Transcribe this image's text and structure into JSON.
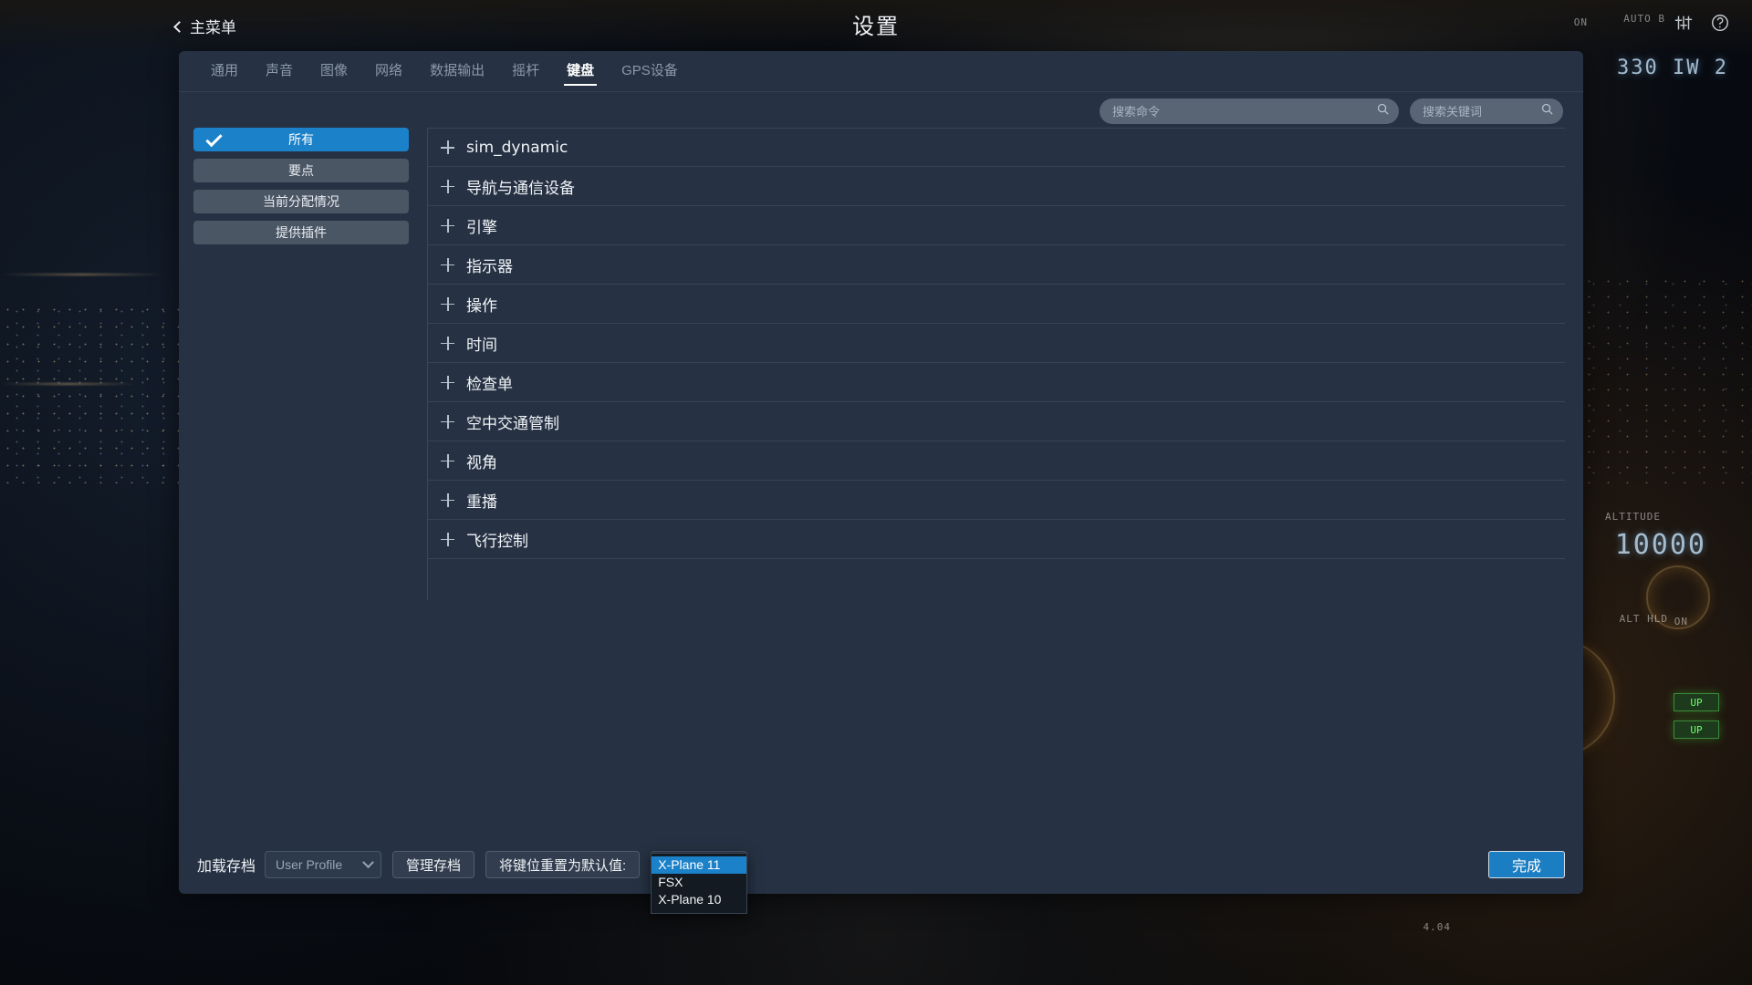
{
  "header": {
    "back_label": "主菜单",
    "title": "设置",
    "icons": [
      {
        "name": "sliders-icon",
        "glyph": "sliders"
      },
      {
        "name": "help-icon",
        "glyph": "question"
      }
    ]
  },
  "tabs": [
    {
      "label": "通用",
      "active": false
    },
    {
      "label": "声音",
      "active": false
    },
    {
      "label": "图像",
      "active": false
    },
    {
      "label": "网络",
      "active": false
    },
    {
      "label": "数据输出",
      "active": false
    },
    {
      "label": "摇杆",
      "active": false
    },
    {
      "label": "键盘",
      "active": true
    },
    {
      "label": "GPS设备",
      "active": false
    }
  ],
  "search": {
    "commands": {
      "value": "",
      "placeholder": "搜索命令",
      "icon": "search-icon"
    },
    "keywords": {
      "value": "",
      "placeholder": "搜索关键词",
      "icon": "search-icon"
    }
  },
  "sidebar": {
    "items": [
      {
        "label": "所有",
        "selected": true
      },
      {
        "label": "要点",
        "selected": false
      },
      {
        "label": "当前分配情况",
        "selected": false
      },
      {
        "label": "提供插件",
        "selected": false
      }
    ]
  },
  "categories": [
    {
      "label": "sim_dynamic",
      "expander": "plus-icon",
      "latin": true
    },
    {
      "label": "导航与通信设备",
      "expander": "plus-icon",
      "latin": false
    },
    {
      "label": "引擎",
      "expander": "plus-icon",
      "latin": false
    },
    {
      "label": "指示器",
      "expander": "plus-icon",
      "latin": false
    },
    {
      "label": "操作",
      "expander": "plus-icon",
      "latin": false
    },
    {
      "label": "时间",
      "expander": "plus-icon",
      "latin": false
    },
    {
      "label": "检查单",
      "expander": "plus-icon",
      "latin": false
    },
    {
      "label": "空中交通管制",
      "expander": "plus-icon",
      "latin": false
    },
    {
      "label": "视角",
      "expander": "plus-icon",
      "latin": false
    },
    {
      "label": "重播",
      "expander": "plus-icon",
      "latin": false
    },
    {
      "label": "飞行控制",
      "expander": "plus-icon",
      "latin": false
    }
  ],
  "bottom_bar": {
    "load_profile_label": "加载存档",
    "profile_select": {
      "value": "User Profile",
      "caret": "chevron-down-icon"
    },
    "manage_profiles_label": "管理存档",
    "reset_label": "将键位重置为默认值:",
    "reset_dropdown": {
      "value": "X-Plane 11",
      "open": true,
      "options": [
        {
          "label": "X-Plane 11",
          "selected": true
        },
        {
          "label": "FSX",
          "selected": false
        },
        {
          "label": "X-Plane 10",
          "selected": false
        }
      ]
    },
    "done_label": "完成"
  },
  "colors": {
    "accent": "#1b81c8",
    "panel": "#263243",
    "sidebar_button": "#4b5665",
    "text_primary": "#f0f3f7",
    "text_muted": "#8c99a9"
  },
  "background_hud": {
    "altitude_label": "ALTITUDE",
    "altitude_value": "10000",
    "alt_hld": "ALT HLD",
    "nav_freq": "330 IW 2",
    "on_label": "ON",
    "auto_label": "AUTO B",
    "up_label": "UP",
    "code_label": "4.04"
  }
}
